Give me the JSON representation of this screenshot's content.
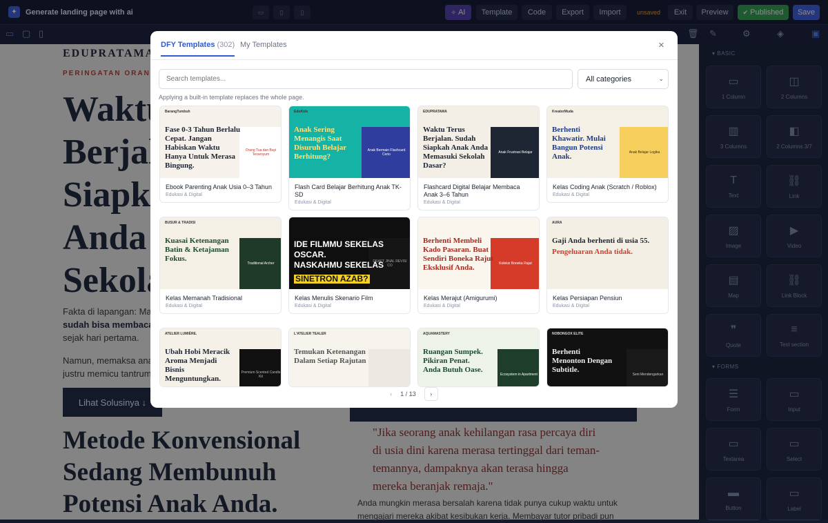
{
  "app": {
    "title": "Generate landing page with ai",
    "status": "unsaved",
    "buttons": {
      "ai": "AI",
      "template": "Template",
      "code": "Code",
      "export": "Export",
      "import": "Import",
      "exit": "Exit",
      "preview": "Preview",
      "published": "Published",
      "save": "Save"
    }
  },
  "sidebar": {
    "basic_label": "BASIC",
    "forms_label": "FORMS",
    "blocks": [
      {
        "label": "1 Column",
        "icon": "single-column-icon"
      },
      {
        "label": "2 Columns",
        "icon": "two-column-icon"
      },
      {
        "label": "3 Columns",
        "icon": "three-column-icon"
      },
      {
        "label": "2 Columns 3/7",
        "icon": "two-column-37-icon"
      },
      {
        "label": "Text",
        "icon": "text-icon"
      },
      {
        "label": "Link",
        "icon": "link-icon"
      },
      {
        "label": "Image",
        "icon": "image-icon"
      },
      {
        "label": "Video",
        "icon": "video-icon"
      },
      {
        "label": "Map",
        "icon": "map-icon"
      },
      {
        "label": "Link Block",
        "icon": "link-block-icon"
      },
      {
        "label": "Quote",
        "icon": "quote-icon"
      },
      {
        "label": "Text section",
        "icon": "text-section-icon"
      }
    ],
    "form_blocks": [
      {
        "label": "Form",
        "icon": "form-icon"
      },
      {
        "label": "Input",
        "icon": "input-icon"
      },
      {
        "label": "Textarea",
        "icon": "textarea-icon"
      },
      {
        "label": "Select",
        "icon": "select-icon"
      },
      {
        "label": "Button",
        "icon": "button-icon"
      },
      {
        "label": "Label",
        "icon": "label-icon"
      }
    ]
  },
  "page": {
    "brand": "EDUPRATAMA",
    "eyebrow": "PERINGATAN ORANG T",
    "headline": "Waktu\nBerjal\nSiapk\nAnda \nSekola",
    "p1": "Fakta di lapangan: Mayo",
    "p1b": "sudah bisa membaca",
    "p1c": "sejak hari pertama.",
    "p2": "Namun, memaksa anak u",
    "p2b": "justru memicu tantrum d",
    "cta": "Lihat Solusinya ↓",
    "h2": "Metode Konvensional\nSedang Membunuh\nPotensi Anak Anda.",
    "quote": "\"Jika seorang anak kehilangan rasa percaya diri\ndi usia dini karena merasa tertinggal dari teman-\ntemannya, dampaknya akan terasa hingga\nmereka beranjak remaja.\"",
    "body2": "Anda mungkin merasa bersalah karena tidak punya cukup waktu untuk\nmengajari mereka akibat kesibukan kerja. Membayar tutor pribadi pun"
  },
  "modal": {
    "tab_dfy": "DFY Templates",
    "tab_dfy_count": "(302)",
    "tab_my": "My Templates",
    "search_placeholder": "Search templates...",
    "category": "All categories",
    "hint": "Applying a built-in template replaces the whole page.",
    "page_indicator": "1 / 13",
    "templates": [
      {
        "title": "Ebook Parenting Anak Usia 0–3 Tahun",
        "category": "Edukasi & Digital",
        "thumb_brand": "BarangTumbuh",
        "thumb_text": "Fase 0-3 Tahun Berlalu\nCepat. Jangan\nHabiskan Waktu\nHanya Untuk Merasa\nBingung.",
        "thumb_side": "Orang Tua dan Bayi Tersenyum"
      },
      {
        "title": "Flash Card Belajar Berhitung Anak TK-SD",
        "category": "Edukasi & Digital",
        "thumb_brand": "EduKids",
        "thumb_text": "Anak Sering\nMenangis Saat\nDisuruh Belajar\nBerhitung?",
        "thumb_side": "Anak Bermain Flashcard Cerio"
      },
      {
        "title": "Flashcard Digital Belajar Membaca Anak 3–6 Tahun",
        "category": "Edukasi & Digital",
        "thumb_brand": "EDUPRATAMA",
        "thumb_text": "Waktu Terus\nBerjalan. Sudah\nSiapkah Anak Anda\nMemasuki Sekolah\nDasar?",
        "thumb_side": "Anak Frustrasi Belajar"
      },
      {
        "title": "Kelas Coding Anak (Scratch / Roblox)",
        "category": "Edukasi & Digital",
        "thumb_brand": "KreatorMuda",
        "thumb_text": "Berhenti\nKhawatir. Mulai\nBangun Potensi\nAnak.",
        "thumb_side": "Anak Belajar Logika"
      },
      {
        "title": "Kelas Memanah Tradisional",
        "category": "Edukasi & Digital",
        "thumb_brand": "BUSUR & TRADISI",
        "thumb_text": "Kuasai Ketenangan\nBatin & Ketajaman\nFokus.",
        "thumb_side": "Traditional Archer"
      },
      {
        "title": "Kelas Menulis Skenario Film",
        "category": "Edukasi & Digital",
        "thumb_brand": "",
        "thumb_text": "IDE FILMMU SEKELAS\nOSCAR.\nNASKAHMU SEKELAS",
        "thumb_hl": "SINETRON AZAB?",
        "thumb_side": "DRAFT JINAL REVISI CO"
      },
      {
        "title": "Kelas Merajut (Amigurumi)",
        "category": "Edukasi & Digital",
        "thumb_brand": "",
        "thumb_text": "Berhenti Membeli\nKado Pasaran. Buat\nSendiri Boneka Rajut\nEksklusif Anda.",
        "thumb_side": "Koleksi Boneka Rajut"
      },
      {
        "title": "Kelas Persiapan Pensiun",
        "category": "Edukasi & Digital",
        "thumb_brand": "AURA",
        "thumb_text": "Gaji Anda berhenti di usia 55.",
        "thumb_hl": "Pengeluaran Anda tidak.",
        "thumb_side": ""
      },
      {
        "title": "",
        "category": "",
        "thumb_brand": "ATELIER LUMIÈRE.",
        "thumb_text": "Ubah Hobi Meracik\nAroma Menjadi\nBisnis\nMenguntungkan.",
        "thumb_side": "Premium Scented Candle Kit"
      },
      {
        "title": "",
        "category": "",
        "thumb_brand": "L'ATELIER TEALER",
        "thumb_text": "Temukan Ketenangan\nDalam Setiap Rajutan",
        "thumb_side": ""
      },
      {
        "title": "",
        "category": "",
        "thumb_brand": "AQUAMASTERY",
        "thumb_text": "Ruangan Sumpek.\nPikiran Penat.\nAnda Butuh Oase.",
        "thumb_side": "Ecosystem in Apartment"
      },
      {
        "title": "",
        "category": "",
        "thumb_brand": "NOBONGOX ELITE",
        "thumb_text": "Berhenti\nMenonton Dengan\nSubtitle.",
        "thumb_side": "Seni Mendengarkan"
      }
    ]
  },
  "colors": {
    "accent": "#2d5bd6",
    "ai": "#4f3aa8",
    "published": "#2f9e44",
    "save": "#3b5bdb",
    "warn": "#e8a43a"
  }
}
